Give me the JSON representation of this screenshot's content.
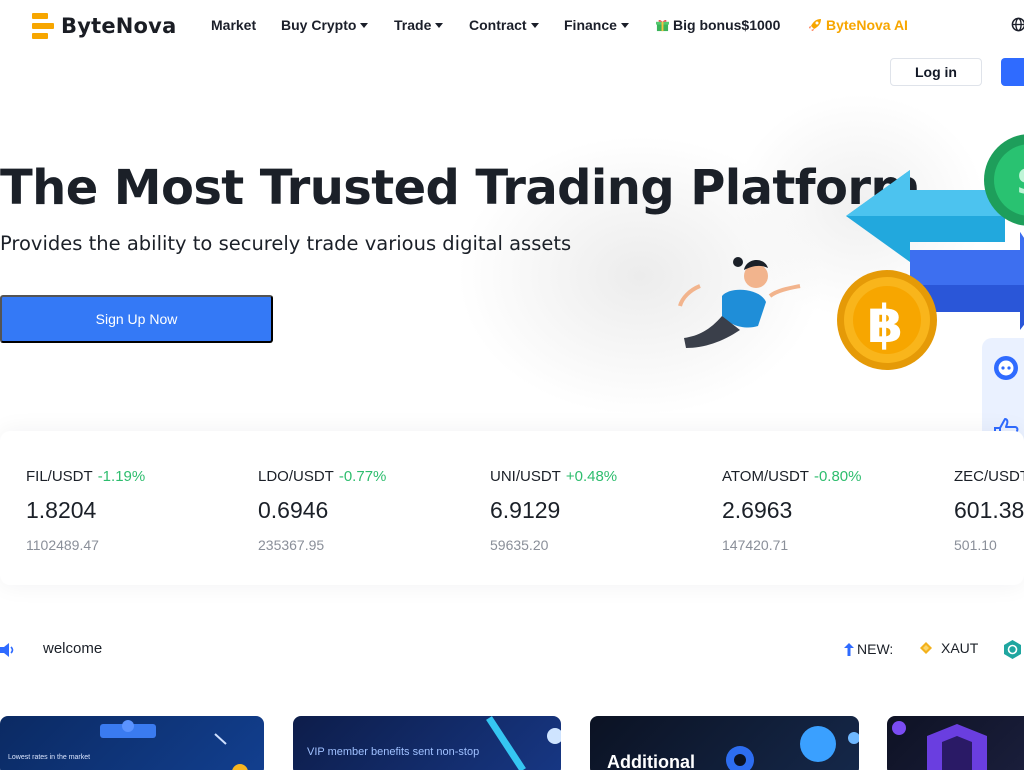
{
  "brand": {
    "name": "ByteNova",
    "accent": "#f7a600",
    "primary": "#3479f6"
  },
  "nav": {
    "market": "Market",
    "buy_crypto": "Buy Crypto",
    "trade": "Trade",
    "contract": "Contract",
    "finance": "Finance",
    "bonus": "Big bonus$1000",
    "ai": "ByteNova AI"
  },
  "auth": {
    "login": "Log in"
  },
  "hero": {
    "title": "The Most Trusted Trading Platform",
    "subtitle": "Provides the ability to securely trade various digital assets",
    "cta": "Sign Up Now"
  },
  "tickers": [
    {
      "pair": "FIL/USDT",
      "change": "-1.19%",
      "price": "1.8204",
      "volume": "1102489.47"
    },
    {
      "pair": "LDO/USDT",
      "change": "-0.77%",
      "price": "0.6946",
      "volume": "235367.95"
    },
    {
      "pair": "UNI/USDT",
      "change": "+0.48%",
      "price": "6.9129",
      "volume": "59635.20"
    },
    {
      "pair": "ATOM/USDT",
      "change": "-0.80%",
      "price": "2.6963",
      "volume": "147420.71"
    },
    {
      "pair": "ZEC/USDT",
      "change": "",
      "price": "601.38",
      "volume": "501.10"
    }
  ],
  "notice": {
    "text": "welcome",
    "new_label": "NEW:",
    "new_coin": "XAUT"
  },
  "banners": {
    "b1_text": "Lowest rates in the market",
    "b2_text": "VIP member benefits sent non-stop",
    "b3_text": "Additional"
  },
  "icons": {
    "logo": "bytenova-logo-icon",
    "globe": "globe-icon",
    "gift": "gift-icon",
    "rocket": "rocket-icon",
    "chat": "chat-icon",
    "like": "thumbs-up-icon",
    "up": "scroll-top-icon",
    "speaker": "speaker-icon"
  }
}
